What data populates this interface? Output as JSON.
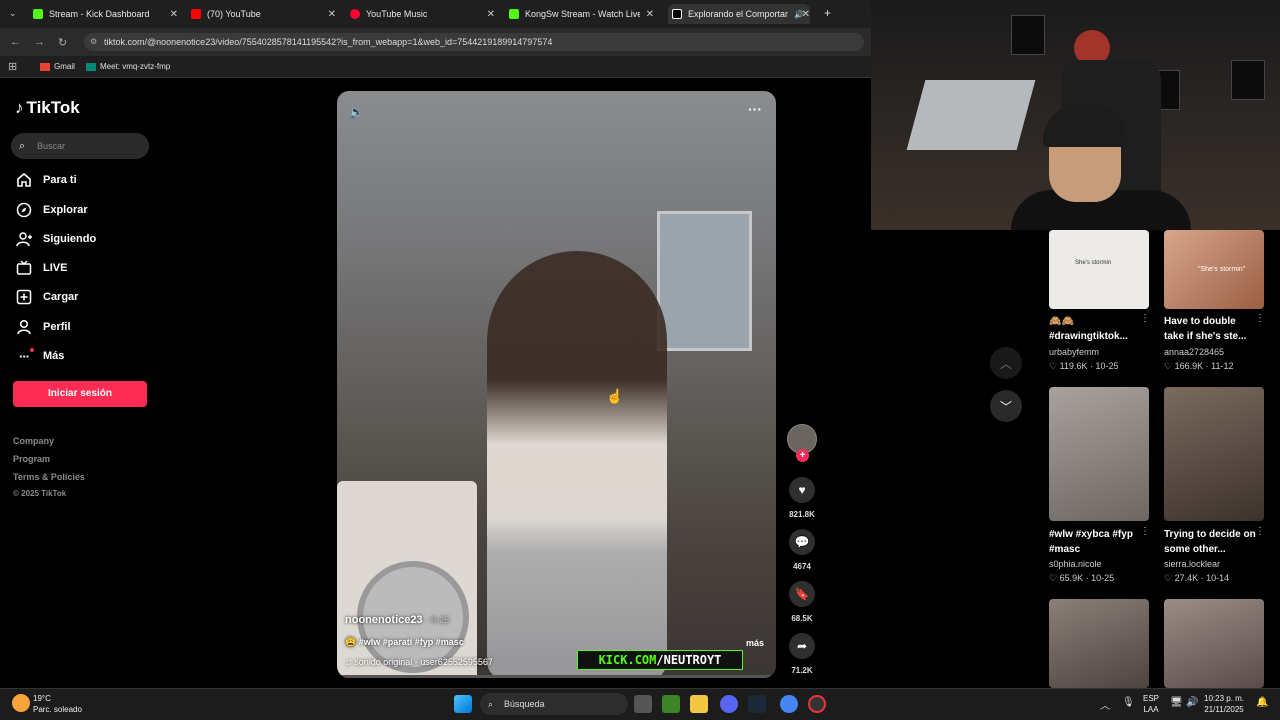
{
  "browser": {
    "tabs": [
      {
        "title": "Stream - Kick Dashboard",
        "color": "#53fc18"
      },
      {
        "title": "(70) YouTube",
        "color": "#ff0000"
      },
      {
        "title": "YouTube Music",
        "color": "#ff0033"
      },
      {
        "title": "KongSw Stream - Watch Live or",
        "color": "#53fc18"
      },
      {
        "title": "Explorando el Comportami",
        "color": "#ffffff"
      }
    ],
    "url": "tiktok.com/@noonenotice23/video/7554028578141195542?is_from_webapp=1&web_id=7544219189914797574",
    "bookmarks": [
      {
        "label": "Gmail"
      },
      {
        "label": "Meet: vmq-zvtz-fmp"
      }
    ]
  },
  "sidebar": {
    "logo": "TikTok",
    "search_placeholder": "Buscar",
    "nav": [
      {
        "label": "Para ti",
        "icon": "home-icon"
      },
      {
        "label": "Explorar",
        "icon": "compass-icon"
      },
      {
        "label": "Siguiendo",
        "icon": "following-icon"
      },
      {
        "label": "LIVE",
        "icon": "live-icon"
      },
      {
        "label": "Cargar",
        "icon": "upload-icon"
      },
      {
        "label": "Perfil",
        "icon": "profile-icon"
      },
      {
        "label": "Más",
        "icon": "more-icon"
      }
    ],
    "login": "Iniciar sesión",
    "footer": [
      "Company",
      "Program",
      "Terms & Policies",
      "© 2025 TikTok"
    ]
  },
  "video": {
    "username": "noonenotice23",
    "date": "· 9-25",
    "description": "😩 #wlw #parati #fyp #masc",
    "more": "más",
    "sound": "sonido original - user62552595567",
    "overlay_prefix": "KICK.COM",
    "overlay_suffix": "/NEUTROYT"
  },
  "actions": {
    "likes": "821.8K",
    "comments": "4674",
    "saves": "68.5K",
    "shares": "71.2K"
  },
  "related": [
    {
      "title": "🙈🙈 #drawingtiktok...",
      "user": "urbabyfemm",
      "likes": "119.6K",
      "date": "10-25",
      "thumb": "#e8e8e6",
      "overlay": "She's stormin"
    },
    {
      "title": "Have to double take if she's ste...",
      "user": "annaa2728465",
      "likes": "166.9K",
      "date": "11-12",
      "thumb": "#c48e72",
      "overlay": "\"She's stormin\""
    },
    {
      "title": "#wlw #xybca #fyp #masc",
      "user": "s0phia.nicole",
      "likes": "65.9K",
      "date": "10-25",
      "thumb": "#8f8a86",
      "overlay": ""
    },
    {
      "title": "Trying to decide on some other...",
      "user": "sierra.locklear",
      "likes": "27.4K",
      "date": "10-14",
      "thumb": "#5b4c43",
      "overlay": ""
    },
    {
      "title": "",
      "user": "",
      "likes": "",
      "date": "",
      "thumb": "#6f6a66",
      "overlay": ""
    },
    {
      "title": "",
      "user": "",
      "likes": "",
      "date": "",
      "thumb": "#7b6e68",
      "overlay": ""
    }
  ],
  "taskbar": {
    "weather_temp": "19°C",
    "weather_desc": "Parc. soleado",
    "search": "Búsqueda",
    "lang_top": "ESP",
    "lang_bottom": "LAA",
    "time": "10:23 p. m.",
    "date": "21/11/2025"
  }
}
